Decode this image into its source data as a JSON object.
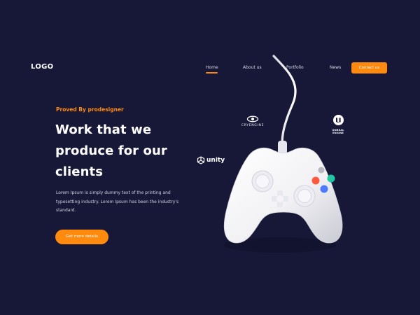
{
  "brand": {
    "logo_text": "LOGO"
  },
  "nav": {
    "items": [
      {
        "label": "Home",
        "active": true
      },
      {
        "label": "About us",
        "active": false
      },
      {
        "label": "Portfolio",
        "active": false
      },
      {
        "label": "News",
        "active": false
      }
    ],
    "contact_label": "Contact us"
  },
  "hero": {
    "eyebrow": "Proved By prodesigner",
    "headline_lines": [
      "Work that we",
      "produce for our",
      "clients"
    ],
    "body_lines": [
      "Lorem Ipsum is simply dummy text of the printing and",
      "typesetting industry. Lorem Ipsum has been the industry's",
      "standard."
    ],
    "cta_label": "Get more details"
  },
  "partners": {
    "cryengine": "CRYENGINE",
    "unreal_line1": "UNREAL",
    "unreal_line2": "ENGINE",
    "unity": "unity"
  },
  "icons": {
    "cryengine_logo": "cryengine-logo-icon",
    "unreal_logo": "unreal-logo-icon",
    "unity_logo": "unity-logo-icon",
    "controller": "game-controller-icon"
  },
  "colors": {
    "background": "#171838",
    "accent": "#ff8a0e",
    "text": "#ffffff",
    "button_red": "#ff5a3d",
    "button_green": "#20c7a2",
    "button_blue": "#4d7bff",
    "button_gray": "#b7b7bf"
  }
}
